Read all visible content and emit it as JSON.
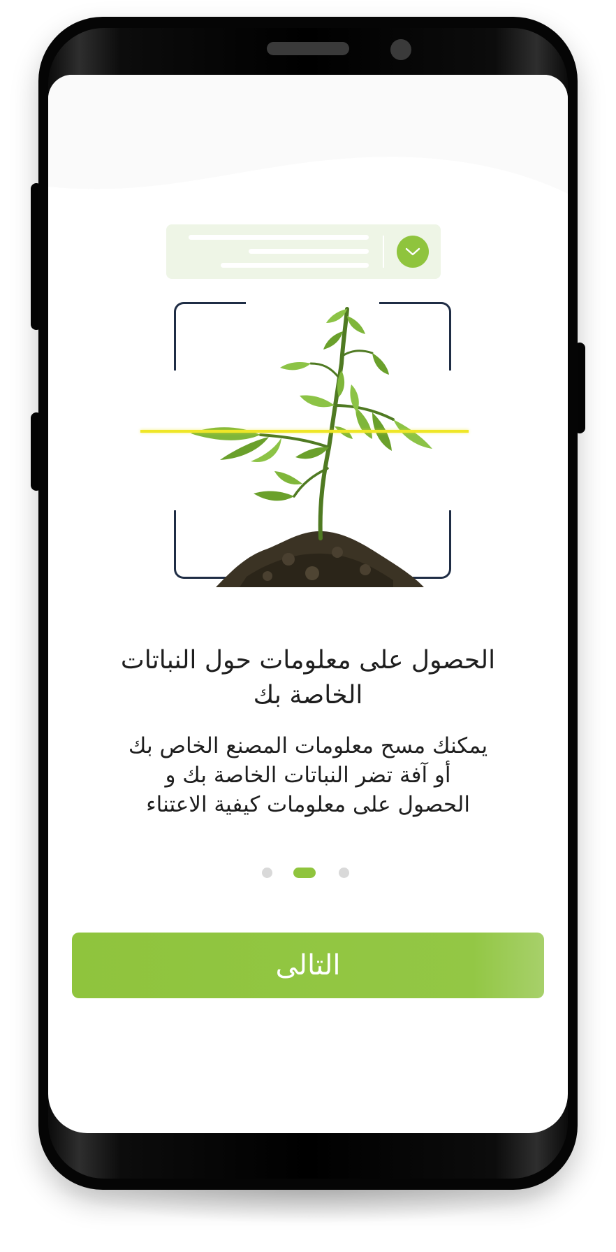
{
  "onboarding": {
    "title_lines": [
      "الحصول على معلومات حول النباتات",
      "الخاصة بك"
    ],
    "description_lines": [
      "يمكنك مسح معلومات المصنع الخاص بك",
      "أو آفة تضر النباتات الخاصة بك و",
      "الحصول على معلومات كيفية الاعتناء"
    ],
    "pager": {
      "page_count": 3,
      "active_index": 1
    },
    "next_button_label": "التالى"
  },
  "icons": {
    "search_action": "chevron-down-icon",
    "illustration": "plant-icon"
  },
  "colors": {
    "accent": "#8fc43d",
    "scan_line": "#efe627",
    "frame": "#1f2d45",
    "search_bar_bg": "#eef5e6",
    "inactive_dot": "#d9d9d9",
    "phone_body": "#050505"
  }
}
